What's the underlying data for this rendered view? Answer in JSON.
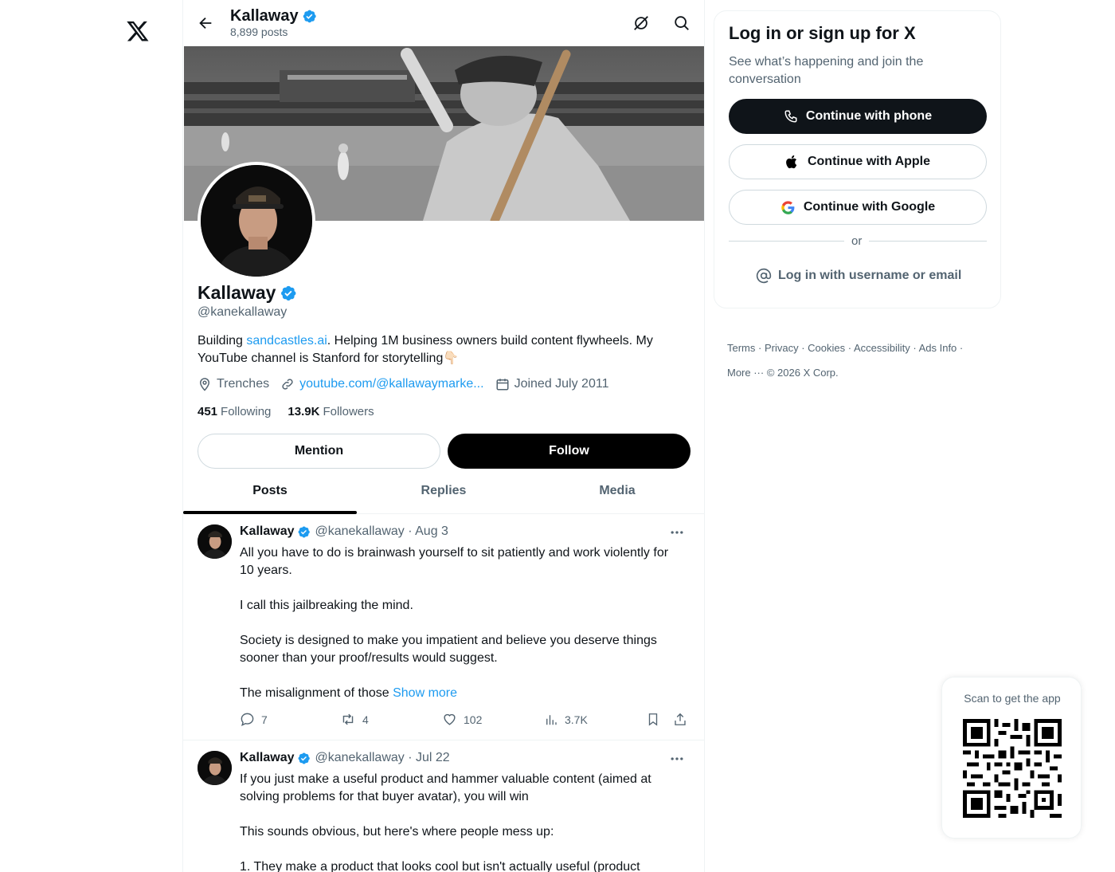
{
  "profile": {
    "name": "Kallaway",
    "posts_count": "8,899 posts",
    "handle": "@kanekallaway",
    "bio_prefix": "Building ",
    "bio_link": "sandcastles.ai",
    "bio_suffix": ". Helping 1M business owners build content flywheels. My YouTube channel is Stanford for storytelling👇🏻",
    "location": "Trenches",
    "website": "youtube.com/@kallawaymarke...",
    "joined": "Joined July 2011",
    "following_count": "451",
    "following_label": "Following",
    "followers_count": "13.9K",
    "followers_label": "Followers"
  },
  "buttons": {
    "mention": "Mention",
    "follow": "Follow"
  },
  "tabs": [
    {
      "label": "Posts",
      "active": true
    },
    {
      "label": "Replies",
      "active": false
    },
    {
      "label": "Media",
      "active": false
    }
  ],
  "posts": [
    {
      "name": "Kallaway",
      "handle_date": "@kanekallaway · Aug 3",
      "paragraphs": [
        "All you have to do is brainwash yourself to sit patiently and work violently for 10 years.",
        "I call this jailbreaking the mind.",
        "Society is designed to make you impatient and believe you deserve things sooner than your proof/results would suggest."
      ],
      "last_text": "The misalignment of those ",
      "show_more": "Show more",
      "replies": "7",
      "reposts": "4",
      "likes": "102",
      "views": "3.7K"
    },
    {
      "name": "Kallaway",
      "handle_date": "@kanekallaway · Jul 22",
      "paragraphs": [
        "If you just make a useful product and hammer valuable content (aimed at solving problems for that buyer avatar), you will win",
        "This sounds obvious, but here's where people mess up:",
        "1. They make a product that looks cool but isn't actually useful (product"
      ]
    }
  ],
  "sidebar": {
    "title": "Log in or sign up for X",
    "subtitle": "See what’s happening and join the conversation",
    "phone": "Continue with phone",
    "apple": "Continue with Apple",
    "google": "Continue with Google",
    "or": "or",
    "login": "Log in with username or email"
  },
  "footer": {
    "links": [
      "Terms",
      "Privacy",
      "Cookies",
      "Accessibility",
      "Ads Info",
      "More ···",
      "© 2026 X Corp."
    ]
  },
  "qr": {
    "caption": "Scan to get the app"
  },
  "colors": {
    "accent": "#1d9bf0",
    "text": "#0f1419",
    "muted": "#536471",
    "border": "#eff3f4"
  }
}
